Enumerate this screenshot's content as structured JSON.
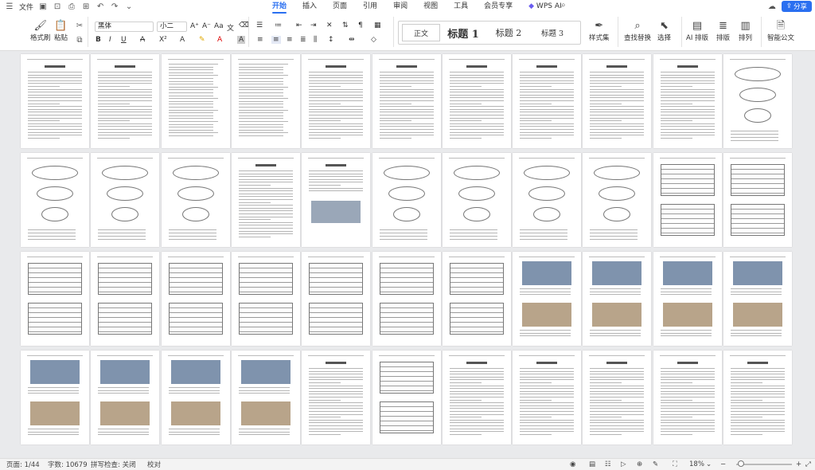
{
  "titlebar": {
    "file_label": "文件",
    "tabs": [
      "开始",
      "插入",
      "页面",
      "引用",
      "审阅",
      "视图",
      "工具",
      "会员专享",
      "WPS AI"
    ],
    "active_tab": "开始",
    "share_label": "分享"
  },
  "ribbon": {
    "format_painter": "格式刷",
    "paste": "粘贴",
    "font_name": "黑体",
    "font_size": "小二",
    "styles": [
      "正文",
      "标题 1",
      "标题 2",
      "标题 3"
    ],
    "style_set": "样式集",
    "find_replace": "查找替换",
    "select": "选择",
    "ai_layout": "AI 排版",
    "layout": "排版",
    "arrange": "排列",
    "smart_doc": "智能公文",
    "accent_color": "#2a6ff0"
  },
  "status": {
    "page": "页面: 1/44",
    "word_count": "字数: 10679",
    "spell_check": "拼写检查: 关闭",
    "proofread": "校对",
    "zoom": "18%"
  },
  "pages": {
    "rows": 4,
    "cols": 11,
    "count": 44
  }
}
